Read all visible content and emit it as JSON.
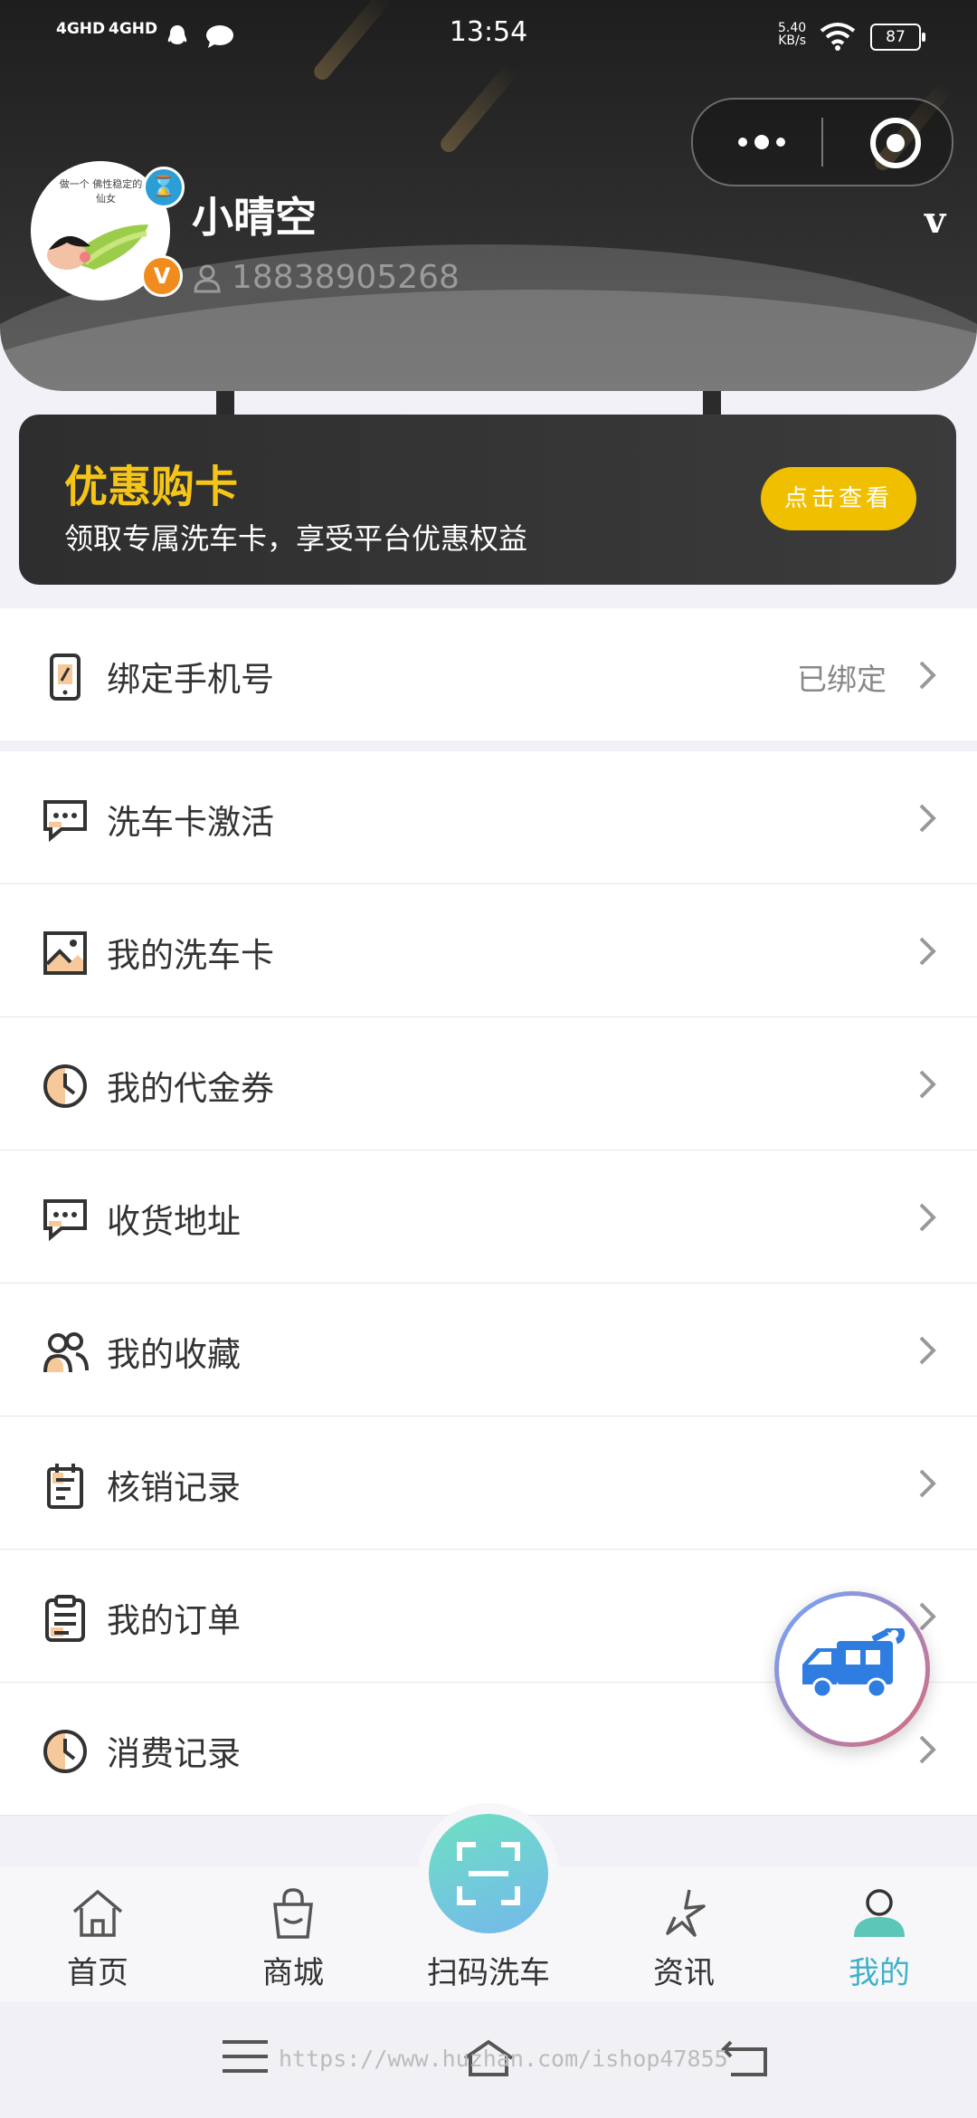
{
  "status_bar": {
    "signal_1": "4GHD",
    "signal_2": "4GHD",
    "time": "13:54",
    "net_speed_value": "5.40",
    "net_speed_unit": "KB/s",
    "battery": "87"
  },
  "profile": {
    "name": "小晴空",
    "phone": "18838905268",
    "avatar_text": "做一个 佛性稳定的小仙女",
    "vip_badge": "V",
    "corner_mark": "v"
  },
  "promo": {
    "title": "优惠购卡",
    "subtitle": "领取专属洗车卡，享受平台优惠权益",
    "button": "点击查看"
  },
  "menu": {
    "bind_phone": {
      "label": "绑定手机号",
      "value": "已绑定"
    },
    "items": [
      {
        "label": "洗车卡激活",
        "icon": "chat-bubble-icon"
      },
      {
        "label": "我的洗车卡",
        "icon": "image-icon"
      },
      {
        "label": "我的代金券",
        "icon": "clock-icon"
      },
      {
        "label": "收货地址",
        "icon": "chat-bubble-icon"
      },
      {
        "label": "我的收藏",
        "icon": "users-icon"
      },
      {
        "label": "核销记录",
        "icon": "calendar-icon"
      },
      {
        "label": "我的订单",
        "icon": "clipboard-icon"
      },
      {
        "label": "消费记录",
        "icon": "clock-icon"
      }
    ]
  },
  "tabbar": {
    "tabs": [
      {
        "label": "首页",
        "icon": "home-icon"
      },
      {
        "label": "商城",
        "icon": "shopping-bag-icon"
      },
      {
        "label": "扫码洗车",
        "icon": "scan-icon"
      },
      {
        "label": "资讯",
        "icon": "star-icon"
      },
      {
        "label": "我的",
        "icon": "user-icon"
      }
    ],
    "active_color": "#3fb0c9"
  },
  "watermark": "https://www.huzhan.com/ishop47855",
  "colors": {
    "promo_title": "#f5c518",
    "promo_button": "#f0c000",
    "icon_accent": "#f6c89a"
  }
}
